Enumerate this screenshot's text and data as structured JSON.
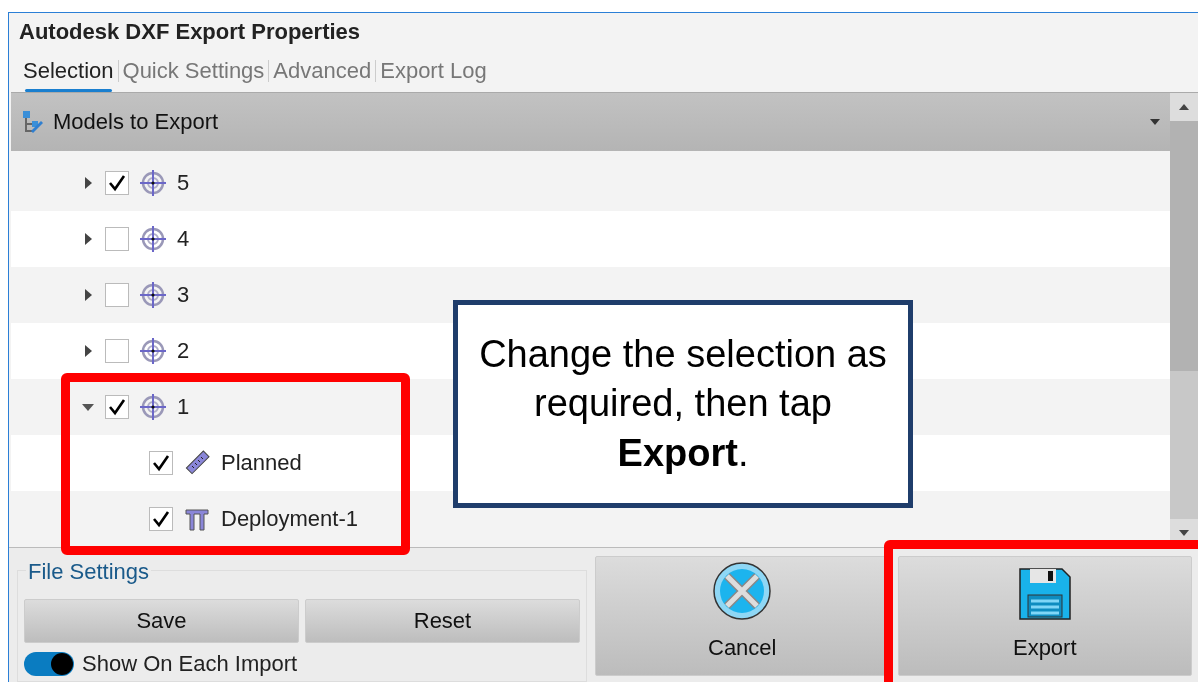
{
  "window": {
    "title": "Autodesk DXF Export Properties"
  },
  "tabs": [
    {
      "label": "Selection",
      "selected": true
    },
    {
      "label": "Quick Settings",
      "selected": false
    },
    {
      "label": "Advanced",
      "selected": false
    },
    {
      "label": "Export Log",
      "selected": false
    }
  ],
  "panel": {
    "title": "Models to Export"
  },
  "tree": [
    {
      "label": "5",
      "kind": "target",
      "checked": true,
      "expanded": false
    },
    {
      "label": "4",
      "kind": "target",
      "checked": false,
      "expanded": false
    },
    {
      "label": "3",
      "kind": "target",
      "checked": false,
      "expanded": false
    },
    {
      "label": "2",
      "kind": "target",
      "checked": false,
      "expanded": false
    },
    {
      "label": "1",
      "kind": "target",
      "checked": true,
      "expanded": true,
      "children": [
        {
          "label": "Planned",
          "kind": "ruler",
          "checked": true
        },
        {
          "label": "Deployment-1",
          "kind": "pillar",
          "checked": true
        }
      ]
    }
  ],
  "file_settings": {
    "title": "File Settings",
    "buttons": [
      "Save",
      "Reset"
    ],
    "toggle": {
      "label": "Show On Each Import",
      "on": true
    }
  },
  "actions": [
    {
      "label": "Cancel",
      "kind": "cancel"
    },
    {
      "label": "Export",
      "kind": "save"
    }
  ],
  "callout": {
    "text": "Change the selection as required, then tap **Export**."
  }
}
